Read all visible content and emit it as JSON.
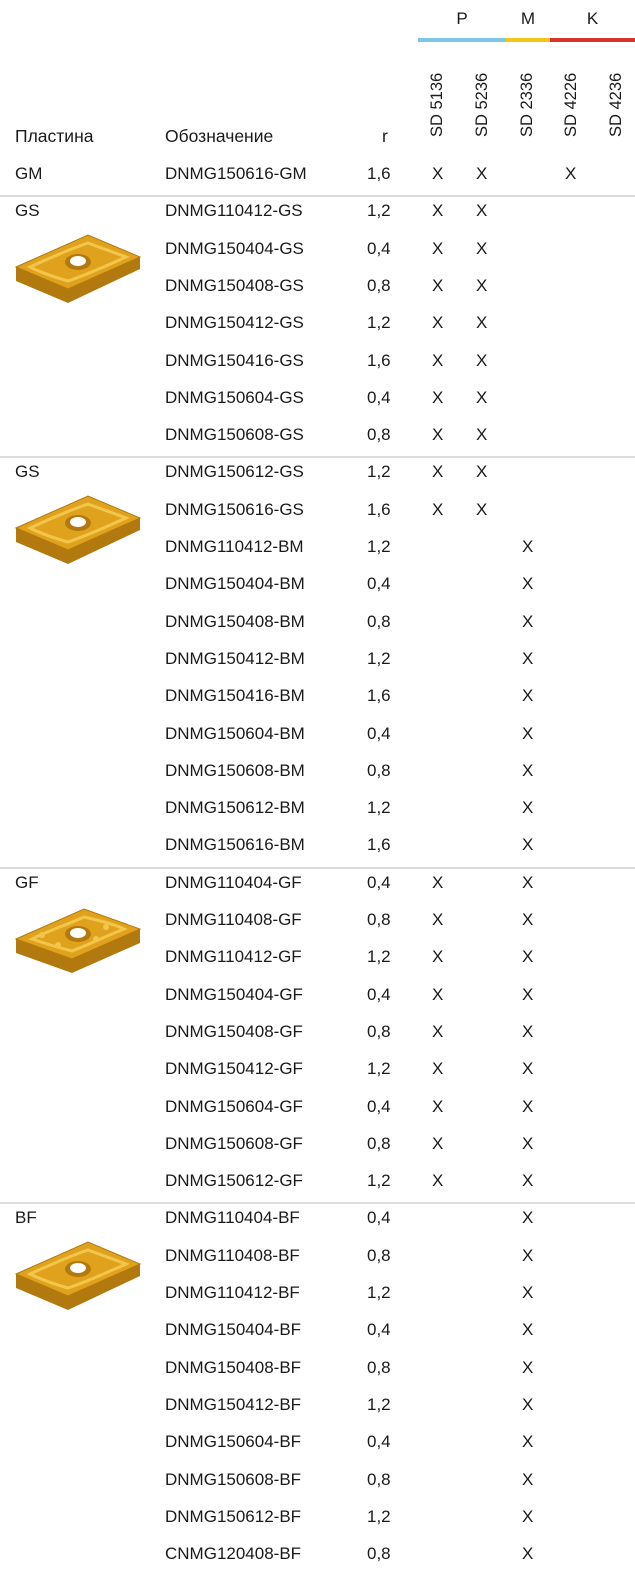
{
  "groups": [
    {
      "label": "P",
      "color": "#7ec6e6"
    },
    {
      "label": "M",
      "color": "#f5c518"
    },
    {
      "label": "K",
      "color": "#d9342b"
    }
  ],
  "grades": [
    "SD 5136",
    "SD 5236",
    "SD 2336",
    "SD 4226",
    "SD 4236"
  ],
  "headers": {
    "plate": "Пластина",
    "designation": "Обозначение",
    "r": "r"
  },
  "mark": "X",
  "sections": [
    {
      "label": "GM",
      "insert_icon": "gm-insert-icon",
      "rows": [
        {
          "code": "DNMG150616-GM",
          "r": "1,6",
          "marks": [
            1,
            1,
            0,
            1,
            0
          ]
        }
      ]
    },
    {
      "label": "GS",
      "insert_icon": "gs-insert-icon",
      "rows": [
        {
          "code": "DNMG110412-GS",
          "r": "1,2",
          "marks": [
            1,
            1,
            0,
            0,
            0
          ]
        },
        {
          "code": "DNMG150404-GS",
          "r": "0,4",
          "marks": [
            1,
            1,
            0,
            0,
            0
          ]
        },
        {
          "code": "DNMG150408-GS",
          "r": "0,8",
          "marks": [
            1,
            1,
            0,
            0,
            0
          ]
        },
        {
          "code": "DNMG150412-GS",
          "r": "1,2",
          "marks": [
            1,
            1,
            0,
            0,
            0
          ]
        },
        {
          "code": "DNMG150416-GS",
          "r": "1,6",
          "marks": [
            1,
            1,
            0,
            0,
            0
          ]
        },
        {
          "code": "DNMG150604-GS",
          "r": "0,4",
          "marks": [
            1,
            1,
            0,
            0,
            0
          ]
        },
        {
          "code": "DNMG150608-GS",
          "r": "0,8",
          "marks": [
            1,
            1,
            0,
            0,
            0
          ]
        }
      ]
    },
    {
      "label": "GS",
      "insert_icon": "gs-insert-icon",
      "rows": [
        {
          "code": "DNMG150612-GS",
          "r": "1,2",
          "marks": [
            1,
            1,
            0,
            0,
            0
          ]
        },
        {
          "code": "DNMG150616-GS",
          "r": "1,6",
          "marks": [
            1,
            1,
            0,
            0,
            0
          ]
        },
        {
          "code": "DNMG110412-BM",
          "r": "1,2",
          "marks": [
            0,
            0,
            1,
            0,
            0
          ]
        },
        {
          "code": "DNMG150404-BM",
          "r": "0,4",
          "marks": [
            0,
            0,
            1,
            0,
            0
          ]
        },
        {
          "code": "DNMG150408-BM",
          "r": "0,8",
          "marks": [
            0,
            0,
            1,
            0,
            0
          ]
        },
        {
          "code": "DNMG150412-BM",
          "r": "1,2",
          "marks": [
            0,
            0,
            1,
            0,
            0
          ]
        },
        {
          "code": "DNMG150416-BM",
          "r": "1,6",
          "marks": [
            0,
            0,
            1,
            0,
            0
          ]
        },
        {
          "code": "DNMG150604-BM",
          "r": "0,4",
          "marks": [
            0,
            0,
            1,
            0,
            0
          ]
        },
        {
          "code": "DNMG150608-BM",
          "r": "0,8",
          "marks": [
            0,
            0,
            1,
            0,
            0
          ]
        },
        {
          "code": "DNMG150612-BM",
          "r": "1,2",
          "marks": [
            0,
            0,
            1,
            0,
            0
          ]
        },
        {
          "code": "DNMG150616-BM",
          "r": "1,6",
          "marks": [
            0,
            0,
            1,
            0,
            0
          ]
        }
      ]
    },
    {
      "label": "GF",
      "insert_icon": "gf-insert-icon",
      "rows": [
        {
          "code": "DNMG110404-GF",
          "r": "0,4",
          "marks": [
            1,
            0,
            1,
            0,
            0
          ]
        },
        {
          "code": "DNMG110408-GF",
          "r": "0,8",
          "marks": [
            1,
            0,
            1,
            0,
            0
          ]
        },
        {
          "code": "DNMG110412-GF",
          "r": "1,2",
          "marks": [
            1,
            0,
            1,
            0,
            0
          ]
        },
        {
          "code": "DNMG150404-GF",
          "r": "0,4",
          "marks": [
            1,
            0,
            1,
            0,
            0
          ]
        },
        {
          "code": "DNMG150408-GF",
          "r": "0,8",
          "marks": [
            1,
            0,
            1,
            0,
            0
          ]
        },
        {
          "code": "DNMG150412-GF",
          "r": "1,2",
          "marks": [
            1,
            0,
            1,
            0,
            0
          ]
        },
        {
          "code": "DNMG150604-GF",
          "r": "0,4",
          "marks": [
            1,
            0,
            1,
            0,
            0
          ]
        },
        {
          "code": "DNMG150608-GF",
          "r": "0,8",
          "marks": [
            1,
            0,
            1,
            0,
            0
          ]
        },
        {
          "code": "DNMG150612-GF",
          "r": "1,2",
          "marks": [
            1,
            0,
            1,
            0,
            0
          ]
        }
      ]
    },
    {
      "label": "BF",
      "insert_icon": "bf-insert-icon",
      "rows": [
        {
          "code": "DNMG110404-BF",
          "r": "0,4",
          "marks": [
            0,
            0,
            1,
            0,
            0
          ]
        },
        {
          "code": "DNMG110408-BF",
          "r": "0,8",
          "marks": [
            0,
            0,
            1,
            0,
            0
          ]
        },
        {
          "code": "DNMG110412-BF",
          "r": "1,2",
          "marks": [
            0,
            0,
            1,
            0,
            0
          ]
        },
        {
          "code": "DNMG150404-BF",
          "r": "0,4",
          "marks": [
            0,
            0,
            1,
            0,
            0
          ]
        },
        {
          "code": "DNMG150408-BF",
          "r": "0,8",
          "marks": [
            0,
            0,
            1,
            0,
            0
          ]
        },
        {
          "code": "DNMG150412-BF",
          "r": "1,2",
          "marks": [
            0,
            0,
            1,
            0,
            0
          ]
        },
        {
          "code": "DNMG150604-BF",
          "r": "0,4",
          "marks": [
            0,
            0,
            1,
            0,
            0
          ]
        },
        {
          "code": "DNMG150608-BF",
          "r": "0,8",
          "marks": [
            0,
            0,
            1,
            0,
            0
          ]
        },
        {
          "code": "DNMG150612-BF",
          "r": "1,2",
          "marks": [
            0,
            0,
            1,
            0,
            0
          ]
        },
        {
          "code": "CNMG120408-BF",
          "r": "0,8",
          "marks": [
            0,
            0,
            1,
            0,
            0
          ]
        }
      ]
    }
  ],
  "colors": {
    "insert_gold": "#e0a21c",
    "insert_dark": "#b27a0e",
    "insert_light": "#f2c64a",
    "separator": "#dcdcdc"
  }
}
